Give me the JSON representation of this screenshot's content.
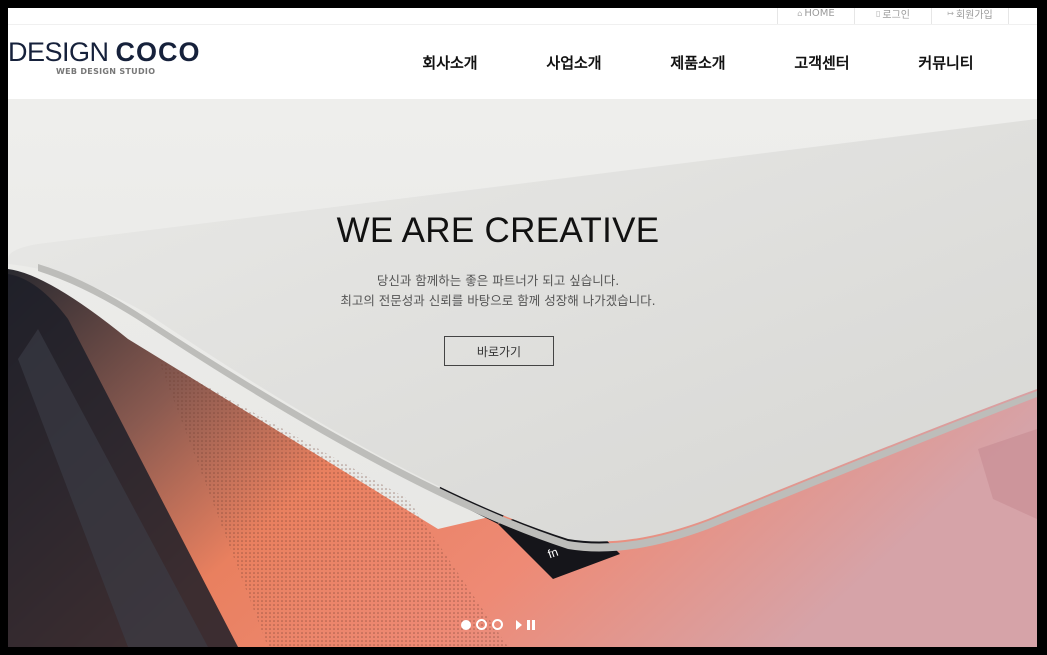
{
  "utility_links": [
    {
      "icon": "home-icon",
      "glyph": "⌂",
      "label": "HOME"
    },
    {
      "icon": "lock-icon",
      "glyph": "▯",
      "label": "로그인"
    },
    {
      "icon": "signup-icon",
      "glyph": "↦",
      "label": "회원가입"
    }
  ],
  "logo": {
    "light": "DESIGN ",
    "bold": "COCO",
    "subtitle": "WEB DESIGN STUDIO"
  },
  "nav": [
    "회사소개",
    "사업소개",
    "제품소개",
    "고객센터",
    "커뮤니티"
  ],
  "hero": {
    "title": "WE ARE CREATIVE",
    "line1": "당신과 함께하는 좋은 파트너가 되고 싶습니다.",
    "line2": "최고의 전문성과 신뢰를 바탕으로 함께 성장해 나가겠습니다.",
    "button": "바로가기",
    "key_label": "fn"
  },
  "slider": {
    "slides": 3,
    "active": 1
  },
  "colors": {
    "brand": "#16213b",
    "accent": "#ee7a5c"
  }
}
